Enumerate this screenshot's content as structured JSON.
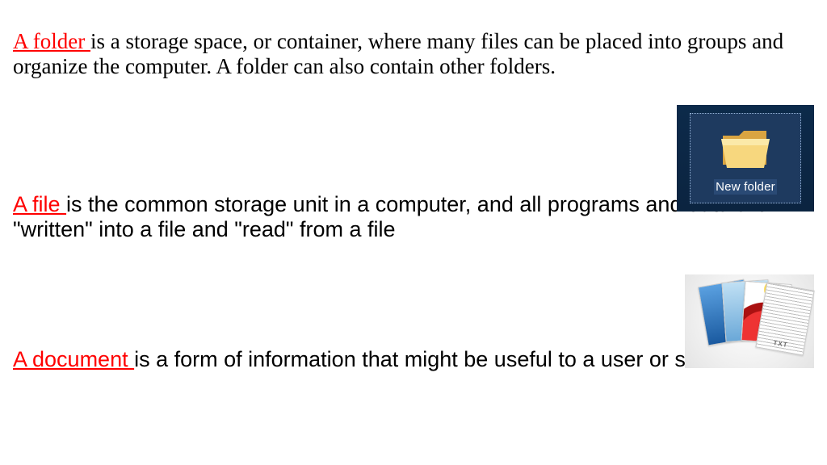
{
  "folder": {
    "term": "A folder ",
    "text": "is a storage space, or container, where many files can be placed into groups and organize the computer. A folder can also contain other folders.",
    "icon_label": "New folder"
  },
  "file": {
    "term": "A file ",
    "text": "is the common storage unit in a computer, and all programs and data are \"written\" into a file and \"read\" from a file",
    "txt_badge": "TXT"
  },
  "document": {
    "term": "A document ",
    "text": "is a form of information that might be useful to a user or set of users."
  }
}
